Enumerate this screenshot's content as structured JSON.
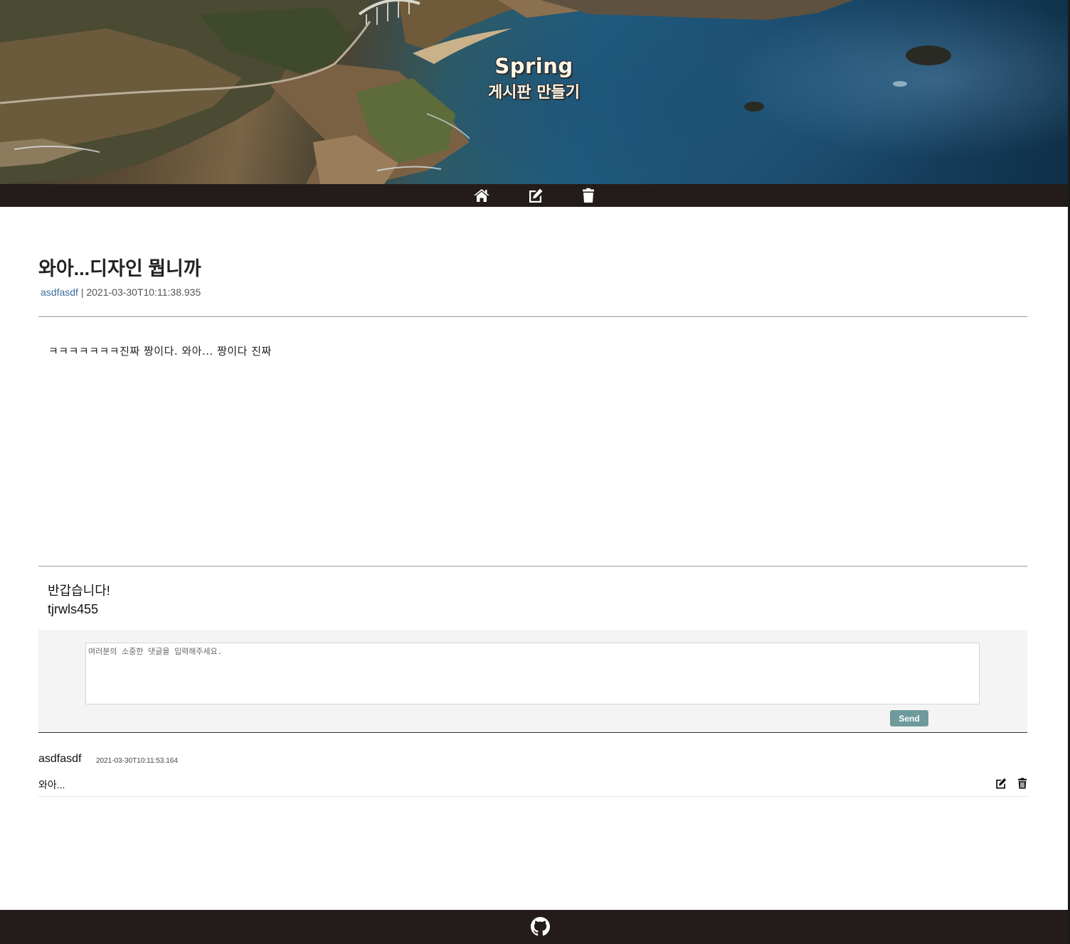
{
  "hero": {
    "title": "Spring",
    "subtitle": "게시판 만들기"
  },
  "nav": {
    "icons": [
      "home-icon",
      "edit-icon",
      "trash-icon"
    ]
  },
  "post": {
    "title": "와아...디자인 뭡니까",
    "author": "asdfasdf",
    "separator": " | ",
    "date": "2021-03-30T10:11:38.935",
    "content": "ㅋㅋㅋㅋㅋㅋㅋ진짜 짱이다. 와아... 짱이다 진짜"
  },
  "session": {
    "greeting": "반갑습니다!",
    "username": "tjrwls455"
  },
  "comment_form": {
    "placeholder": "여러분의 소중한 댓글을 입력해주세요.",
    "send_label": "Send",
    "send_color": "#6f9a9c"
  },
  "comments": [
    {
      "author": "asdfasdf",
      "date": "2021-03-30T10:11:53.164",
      "text": "와아..."
    }
  ],
  "colors": {
    "bar": "#231c1b",
    "author_link": "#3d6d9c"
  },
  "footer": {
    "icon": "github-icon"
  }
}
